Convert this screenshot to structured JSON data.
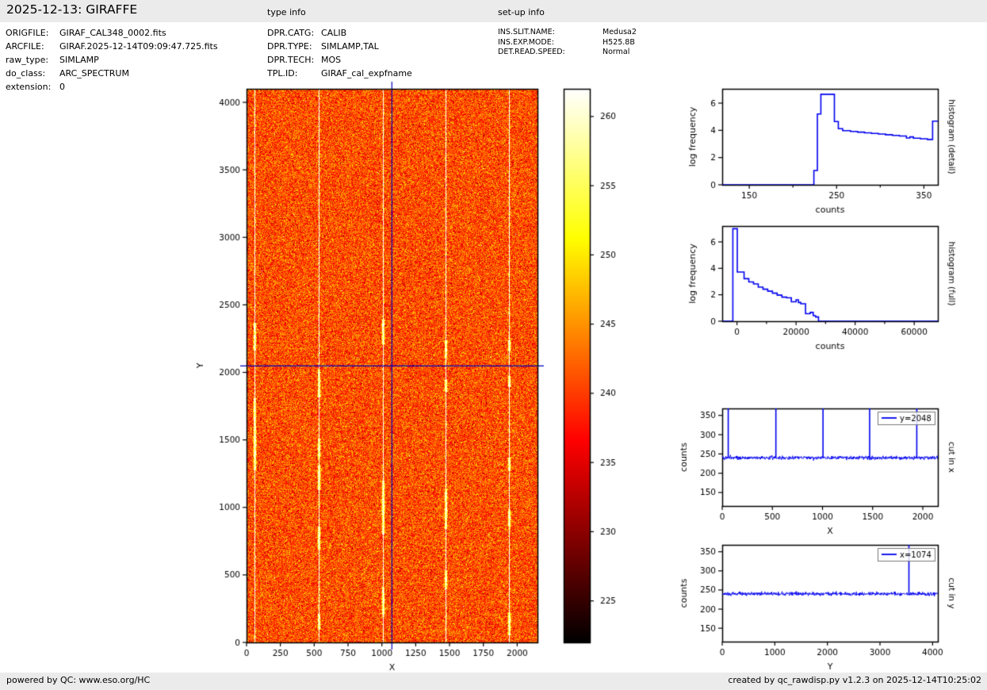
{
  "header": {
    "title": "2025-12-13: GIRAFFE",
    "type_info_label": "type info",
    "setup_info_label": "set-up info"
  },
  "file_info": {
    "rows": [
      {
        "label": "ORIGFILE:",
        "value": "GIRAF_CAL348_0002.fits"
      },
      {
        "label": "ARCFILE:",
        "value": "GIRAF.2025-12-14T09:09:47.725.fits"
      },
      {
        "label": "raw_type:",
        "value": "SIMLAMP"
      },
      {
        "label": "do_class:",
        "value": "ARC_SPECTRUM"
      },
      {
        "label": "extension:",
        "value": "0"
      }
    ]
  },
  "type_info": {
    "rows": [
      {
        "label": "DPR.CATG:",
        "value": "CALIB"
      },
      {
        "label": "DPR.TYPE:",
        "value": "SIMLAMP,TAL"
      },
      {
        "label": "DPR.TECH:",
        "value": "MOS"
      },
      {
        "label": "TPL.ID:",
        "value": "GIRAF_cal_expfname"
      }
    ]
  },
  "setup_info": {
    "rows": [
      {
        "label": "INS.SLIT.NAME:",
        "value": "Medusa2"
      },
      {
        "label": "INS.EXP.MODE:",
        "value": "H525.8B"
      },
      {
        "label": "DET.READ.SPEED:",
        "value": "Normal"
      }
    ]
  },
  "footer": {
    "left": "powered by QC: www.eso.org/HC",
    "right": "created by qc_rawdisp.py v1.2.3 on 2025-12-14T10:25:02"
  },
  "chart_data": [
    {
      "type": "heatmap",
      "name": "raw-frame-image",
      "xlabel": "X",
      "ylabel": "Y",
      "xlim": [
        0,
        2150
      ],
      "ylim": [
        0,
        4100
      ],
      "xticks": [
        0,
        250,
        500,
        750,
        1000,
        1250,
        1500,
        1750,
        2000
      ],
      "yticks": [
        0,
        500,
        1000,
        1500,
        2000,
        2500,
        3000,
        3500,
        4000
      ],
      "background_level": 241,
      "noise_sigma": 4,
      "fiber_lines_x": [
        60,
        535,
        1005,
        1470,
        1940
      ],
      "crosshair": {
        "x": 1074,
        "y": 2048,
        "color": "#0000bb"
      },
      "colormap": "hot",
      "colorbar": {
        "vmin": 222,
        "vmax": 262,
        "ticks": [
          225,
          230,
          235,
          240,
          245,
          250,
          255,
          260
        ]
      }
    },
    {
      "type": "line",
      "name": "histogram-detail",
      "right_label": "histogram (detail)",
      "xlabel": "counts",
      "ylabel": "log frequency",
      "xlim": [
        119,
        366
      ],
      "ylim": [
        0,
        7.05
      ],
      "xticks": [
        150,
        250,
        350
      ],
      "xticks_minor": [
        200,
        300
      ],
      "yticks": [
        0,
        2,
        4,
        6
      ],
      "color": "#0000ee",
      "steps": [
        [
          119,
          0
        ],
        [
          224,
          0
        ],
        [
          224,
          1.05
        ],
        [
          228,
          1.05
        ],
        [
          228,
          5.2
        ],
        [
          232,
          5.2
        ],
        [
          232,
          6.65
        ],
        [
          247.5,
          6.65
        ],
        [
          247.5,
          4.65
        ],
        [
          252,
          4.65
        ],
        [
          252,
          4.12
        ],
        [
          257,
          4.12
        ],
        [
          257,
          3.98
        ],
        [
          266,
          3.98
        ],
        [
          266,
          3.92
        ],
        [
          274,
          3.92
        ],
        [
          274,
          3.87
        ],
        [
          282,
          3.87
        ],
        [
          282,
          3.82
        ],
        [
          290,
          3.82
        ],
        [
          290,
          3.77
        ],
        [
          298,
          3.77
        ],
        [
          298,
          3.73
        ],
        [
          306,
          3.73
        ],
        [
          306,
          3.68
        ],
        [
          314,
          3.68
        ],
        [
          314,
          3.63
        ],
        [
          322,
          3.63
        ],
        [
          322,
          3.58
        ],
        [
          330,
          3.58
        ],
        [
          330,
          3.44
        ],
        [
          334,
          3.44
        ],
        [
          334,
          3.52
        ],
        [
          338,
          3.52
        ],
        [
          338,
          3.42
        ],
        [
          346,
          3.42
        ],
        [
          346,
          3.38
        ],
        [
          354,
          3.38
        ],
        [
          354,
          3.33
        ],
        [
          360,
          3.33
        ],
        [
          360,
          4.68
        ],
        [
          366,
          4.68
        ]
      ]
    },
    {
      "type": "line",
      "name": "histogram-full",
      "right_label": "histogram (full)",
      "xlabel": "counts",
      "ylabel": "log frequency",
      "xlim": [
        -5000,
        68000
      ],
      "ylim": [
        0,
        7.2
      ],
      "xticks": [
        0,
        20000,
        40000,
        60000
      ],
      "xticks_minor": [
        10000,
        30000,
        50000
      ],
      "yticks": [
        0,
        2,
        4,
        6
      ],
      "color": "#0000ee",
      "steps": [
        [
          -4800,
          0
        ],
        [
          -1400,
          0
        ],
        [
          -1400,
          7.0
        ],
        [
          100,
          7.0
        ],
        [
          100,
          3.72
        ],
        [
          2400,
          3.72
        ],
        [
          2400,
          3.22
        ],
        [
          4000,
          3.22
        ],
        [
          4000,
          2.97
        ],
        [
          5600,
          2.97
        ],
        [
          5600,
          2.82
        ],
        [
          7200,
          2.82
        ],
        [
          7200,
          2.58
        ],
        [
          8800,
          2.58
        ],
        [
          8800,
          2.42
        ],
        [
          10400,
          2.42
        ],
        [
          10400,
          2.27
        ],
        [
          12000,
          2.27
        ],
        [
          12000,
          2.12
        ],
        [
          13600,
          2.12
        ],
        [
          13600,
          1.97
        ],
        [
          15200,
          1.97
        ],
        [
          15200,
          1.82
        ],
        [
          16800,
          1.82
        ],
        [
          16800,
          1.77
        ],
        [
          18400,
          1.77
        ],
        [
          18400,
          1.47
        ],
        [
          20000,
          1.47
        ],
        [
          20000,
          1.62
        ],
        [
          20800,
          1.62
        ],
        [
          20800,
          1.42
        ],
        [
          21600,
          1.42
        ],
        [
          21600,
          1.32
        ],
        [
          23200,
          1.32
        ],
        [
          23200,
          0.57
        ],
        [
          24800,
          0.57
        ],
        [
          24800,
          0.67
        ],
        [
          25800,
          0.67
        ],
        [
          25800,
          0.42
        ],
        [
          26600,
          0.42
        ],
        [
          26600,
          0.32
        ],
        [
          27600,
          0.32
        ],
        [
          27600,
          0
        ],
        [
          68000,
          0
        ]
      ]
    },
    {
      "type": "line",
      "name": "cut-in-x",
      "right_label": "cut in x",
      "legend": "y=2048",
      "xlabel": "X",
      "ylabel": "counts",
      "xlim": [
        0,
        2150
      ],
      "ylim": [
        115,
        368
      ],
      "xticks": [
        0,
        500,
        1000,
        1500,
        2000
      ],
      "yticks": [
        150,
        200,
        250,
        300,
        350
      ],
      "color": "#0000ee",
      "baseline": 240,
      "noise_sigma": 2.3,
      "spikes_x": [
        60,
        535,
        1005,
        1470,
        1940
      ]
    },
    {
      "type": "line",
      "name": "cut-in-y",
      "right_label": "cut in y",
      "legend": "x=1074",
      "xlabel": "Y",
      "ylabel": "counts",
      "xlim": [
        0,
        4100
      ],
      "ylim": [
        115,
        368
      ],
      "xticks": [
        0,
        1000,
        2000,
        3000,
        4000
      ],
      "yticks": [
        150,
        200,
        250,
        300,
        350
      ],
      "color": "#0000ee",
      "baseline": 240,
      "noise_sigma": 2.3,
      "spikes_x": [
        3550
      ]
    }
  ]
}
